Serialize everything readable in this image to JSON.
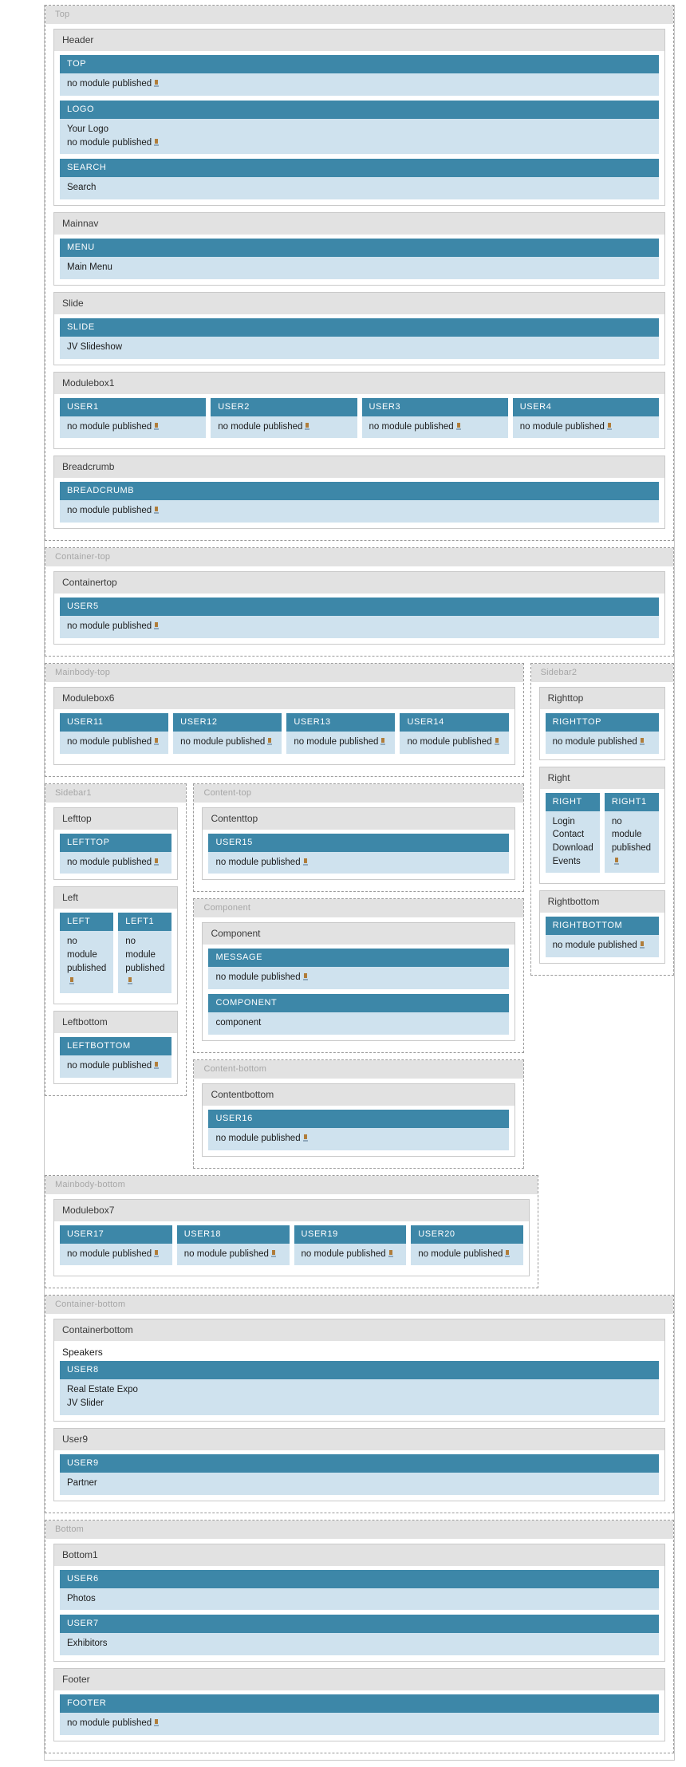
{
  "labels": {
    "no_module": "no module published",
    "warn_icon": "warning-icon"
  },
  "sections": {
    "top": {
      "title": "Top",
      "blocks": {
        "header": {
          "title": "Header",
          "modules": [
            {
              "head": "TOP",
              "lines": [
                "no module published"
              ],
              "warn": true
            },
            {
              "head": "LOGO",
              "lines": [
                "Your Logo",
                "no module published"
              ],
              "warn": true
            },
            {
              "head": "SEARCH",
              "lines": [
                "Search"
              ],
              "warn": false
            }
          ]
        },
        "mainnav": {
          "title": "Mainnav",
          "modules": [
            {
              "head": "MENU",
              "lines": [
                "Main Menu"
              ],
              "warn": false
            }
          ]
        },
        "slide": {
          "title": "Slide",
          "modules": [
            {
              "head": "SLIDE",
              "lines": [
                "JV Slideshow"
              ],
              "warn": false
            }
          ]
        },
        "modulebox1": {
          "title": "Modulebox1",
          "columns": [
            {
              "head": "USER1",
              "lines": [
                "no module published"
              ],
              "warn": true
            },
            {
              "head": "USER2",
              "lines": [
                "no module published"
              ],
              "warn": true
            },
            {
              "head": "USER3",
              "lines": [
                "no module published"
              ],
              "warn": true
            },
            {
              "head": "USER4",
              "lines": [
                "no module published"
              ],
              "warn": true
            }
          ]
        },
        "breadcrumb": {
          "title": "Breadcrumb",
          "modules": [
            {
              "head": "BREADCRUMB",
              "lines": [
                "no module published"
              ],
              "warn": true
            }
          ]
        }
      }
    },
    "container_top": {
      "title": "Container-top",
      "blocks": {
        "containertop": {
          "title": "Containertop",
          "modules": [
            {
              "head": "USER5",
              "lines": [
                "no module published"
              ],
              "warn": true
            }
          ]
        }
      }
    },
    "mainbody_top": {
      "title": "Mainbody-top",
      "blocks": {
        "modulebox6": {
          "title": "Modulebox6",
          "columns": [
            {
              "head": "USER11",
              "lines": [
                "no module published"
              ],
              "warn": true
            },
            {
              "head": "USER12",
              "lines": [
                "no module published"
              ],
              "warn": true
            },
            {
              "head": "USER13",
              "lines": [
                "no module published"
              ],
              "warn": true
            },
            {
              "head": "USER14",
              "lines": [
                "no module published"
              ],
              "warn": true
            }
          ]
        }
      }
    },
    "sidebar2": {
      "title": "Sidebar2",
      "blocks": {
        "righttop": {
          "title": "Righttop",
          "modules": [
            {
              "head": "RIGHTTOP",
              "lines": [
                "no module published"
              ],
              "warn": true
            }
          ]
        },
        "right": {
          "title": "Right",
          "columns": [
            {
              "head": "RIGHT",
              "lines": [
                "Login",
                "Contact",
                "Download",
                "Events"
              ],
              "warn": false
            },
            {
              "head": "RIGHT1",
              "lines": [
                "no module published"
              ],
              "warn": true
            }
          ]
        },
        "rightbottom": {
          "title": "Rightbottom",
          "modules": [
            {
              "head": "RIGHTBOTTOM",
              "lines": [
                "no module published"
              ],
              "warn": true
            }
          ]
        }
      }
    },
    "sidebar1": {
      "title": "Sidebar1",
      "blocks": {
        "lefttop": {
          "title": "Lefttop",
          "modules": [
            {
              "head": "LEFTTOP",
              "lines": [
                "no module published"
              ],
              "warn": true
            }
          ]
        },
        "left": {
          "title": "Left",
          "columns": [
            {
              "head": "LEFT",
              "lines": [
                "no module published"
              ],
              "warn": true
            },
            {
              "head": "LEFT1",
              "lines": [
                "no module published"
              ],
              "warn": true
            }
          ]
        },
        "leftbottom": {
          "title": "Leftbottom",
          "modules": [
            {
              "head": "LEFTBOTTOM",
              "lines": [
                "no module published"
              ],
              "warn": true
            }
          ]
        }
      }
    },
    "content_top": {
      "title": "Content-top",
      "blocks": {
        "contenttop": {
          "title": "Contenttop",
          "modules": [
            {
              "head": "USER15",
              "lines": [
                "no module published"
              ],
              "warn": true
            }
          ]
        }
      }
    },
    "component": {
      "title": "Component",
      "blocks": {
        "component": {
          "title": "Component",
          "modules": [
            {
              "head": "MESSAGE",
              "lines": [
                "no module published"
              ],
              "warn": true
            },
            {
              "head": "COMPONENT",
              "lines": [
                "component"
              ],
              "warn": false
            }
          ]
        }
      }
    },
    "content_bottom": {
      "title": "Content-bottom",
      "blocks": {
        "contentbottom": {
          "title": "Contentbottom",
          "modules": [
            {
              "head": "USER16",
              "lines": [
                "no module published"
              ],
              "warn": true
            }
          ]
        }
      }
    },
    "mainbody_bottom": {
      "title": "Mainbody-bottom",
      "blocks": {
        "modulebox7": {
          "title": "Modulebox7",
          "columns": [
            {
              "head": "USER17",
              "lines": [
                "no module published"
              ],
              "warn": true
            },
            {
              "head": "USER18",
              "lines": [
                "no module published"
              ],
              "warn": true
            },
            {
              "head": "USER19",
              "lines": [
                "no module published"
              ],
              "warn": true
            },
            {
              "head": "USER20",
              "lines": [
                "no module published"
              ],
              "warn": true
            }
          ]
        }
      }
    },
    "container_bottom": {
      "title": "Container-bottom",
      "blocks": {
        "containerbottom": {
          "title": "Containerbottom",
          "plain": "Speakers",
          "modules": [
            {
              "head": "USER8",
              "lines": [
                "Real Estate Expo",
                "JV Slider"
              ],
              "warn": false
            }
          ]
        },
        "user9": {
          "title": "User9",
          "modules": [
            {
              "head": "USER9",
              "lines": [
                "Partner"
              ],
              "warn": false
            }
          ]
        }
      }
    },
    "bottom": {
      "title": "Bottom",
      "blocks": {
        "bottom1": {
          "title": "Bottom1",
          "modules": [
            {
              "head": "USER6",
              "lines": [
                "Photos"
              ],
              "warn": false
            },
            {
              "head": "USER7",
              "lines": [
                "Exhibitors"
              ],
              "warn": false
            }
          ]
        },
        "footer": {
          "title": "Footer",
          "modules": [
            {
              "head": "FOOTER",
              "lines": [
                "no module published"
              ],
              "warn": true
            }
          ]
        }
      }
    }
  }
}
